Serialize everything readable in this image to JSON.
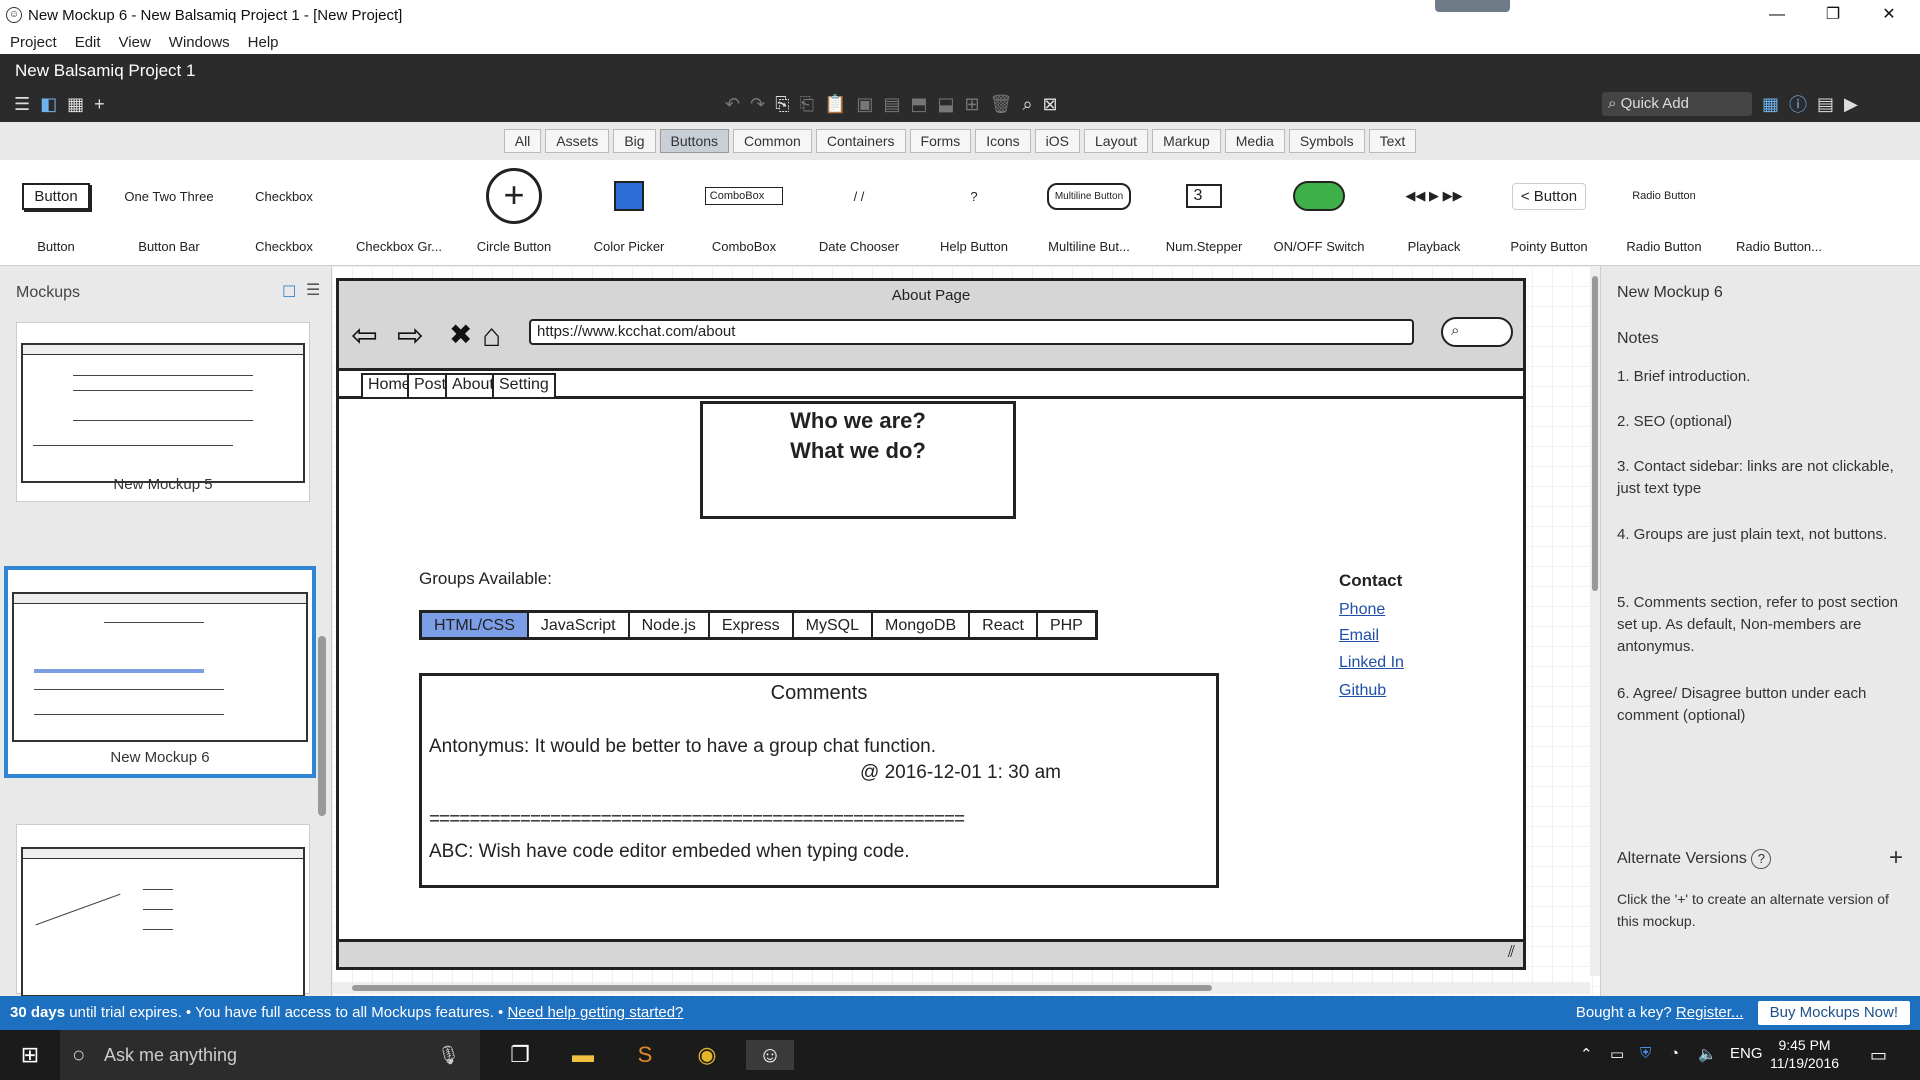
{
  "window": {
    "title": "New Mockup 6 - New Balsamiq Project 1 - [New Project]",
    "controls": [
      "—",
      "❐",
      "✕"
    ]
  },
  "menu": [
    "Project",
    "Edit",
    "View",
    "Windows",
    "Help"
  ],
  "header": {
    "project_name": "New Balsamiq Project 1",
    "quick_add_placeholder": "Quick Add"
  },
  "filters": {
    "items": [
      "All",
      "Assets",
      "Big",
      "Buttons",
      "Common",
      "Containers",
      "Forms",
      "Icons",
      "iOS",
      "Layout",
      "Markup",
      "Media",
      "Symbols",
      "Text"
    ],
    "active": "Buttons"
  },
  "components": [
    {
      "label": "Button",
      "preview": "Button"
    },
    {
      "label": "Button Bar",
      "preview": "One Two Three"
    },
    {
      "label": "Checkbox",
      "preview": "Checkbox"
    },
    {
      "label": "Checkbox Gr...",
      "preview": ""
    },
    {
      "label": "Circle Button",
      "preview": "+"
    },
    {
      "label": "Color Picker",
      "preview": ""
    },
    {
      "label": "ComboBox",
      "preview": "ComboBox"
    },
    {
      "label": "Date Chooser",
      "preview": "/ /"
    },
    {
      "label": "Help Button",
      "preview": "?"
    },
    {
      "label": "Multiline But...",
      "preview": "Multiline Button"
    },
    {
      "label": "Num.Stepper",
      "preview": "3"
    },
    {
      "label": "ON/OFF Switch",
      "preview": ""
    },
    {
      "label": "Playback",
      "preview": "◀◀ ▶ ▶▶"
    },
    {
      "label": "Pointy Button",
      "preview": "< Button"
    },
    {
      "label": "Radio Button",
      "preview": "Radio Button"
    },
    {
      "label": "Radio Button...",
      "preview": ""
    }
  ],
  "mockups_panel": {
    "header": "Mockups",
    "items": [
      {
        "name": "New Mockup 5",
        "selected": false
      },
      {
        "name": "New Mockup 6",
        "selected": true
      },
      {
        "name": "",
        "selected": false
      }
    ]
  },
  "mockup": {
    "page_title": "About Page",
    "url": "https://www.kcchat.com/about",
    "tabs": [
      "Home",
      "Post",
      "About",
      "Setting"
    ],
    "hero_line1": "Who we are?",
    "hero_line2": "What we do?",
    "groups_label": "Groups Available:",
    "groups": [
      "HTML/CSS",
      "JavaScript",
      "Node.js",
      "Express",
      "MySQL",
      "MongoDB",
      "React",
      "PHP"
    ],
    "groups_active": "HTML/CSS",
    "contact_title": "Contact",
    "contact_links": [
      "Phone",
      "Email",
      "Linked In",
      "Github"
    ],
    "comments_title": "Comments",
    "comment1": "Antonymus:  It would be better to have a group chat function.",
    "comment1_time": "@ 2016-12-01  1: 30 am",
    "separator": "=====================================================",
    "comment2": "ABC: Wish have code editor embeded when typing code."
  },
  "notes_panel": {
    "mockup_name": "New Mockup 6",
    "notes_header": "Notes",
    "notes": [
      "1. Brief introduction.",
      "2. SEO (optional)",
      "3. Contact sidebar: links are not clickable, just text type",
      "4. Groups are just plain text, not buttons.",
      "5. Comments section, refer to post section set up. As default,  Non-members are antonymus.",
      "6. Agree/ Disagree button under each comment (optional)"
    ],
    "alt_header": "Alternate Versions",
    "alt_text": "Click the '+' to create an alternate version of this mockup."
  },
  "trial_bar": {
    "days": "30 days",
    "text": " until trial expires.  •  You have full access to all Mockups features.  •  ",
    "help_link": "Need help getting started?",
    "bought": "Bought a key? ",
    "register": "Register...",
    "buy": "Buy Mockups Now!"
  },
  "taskbar": {
    "search_placeholder": "Ask me anything",
    "lang": "ENG",
    "time": "9:45 PM",
    "date": "11/19/2016"
  },
  "colors": {
    "dark_header": "#2b2b2b",
    "selection_blue": "#2f86d4",
    "trial_blue": "#1d6fbf",
    "group_active": "#7c9ee6"
  }
}
